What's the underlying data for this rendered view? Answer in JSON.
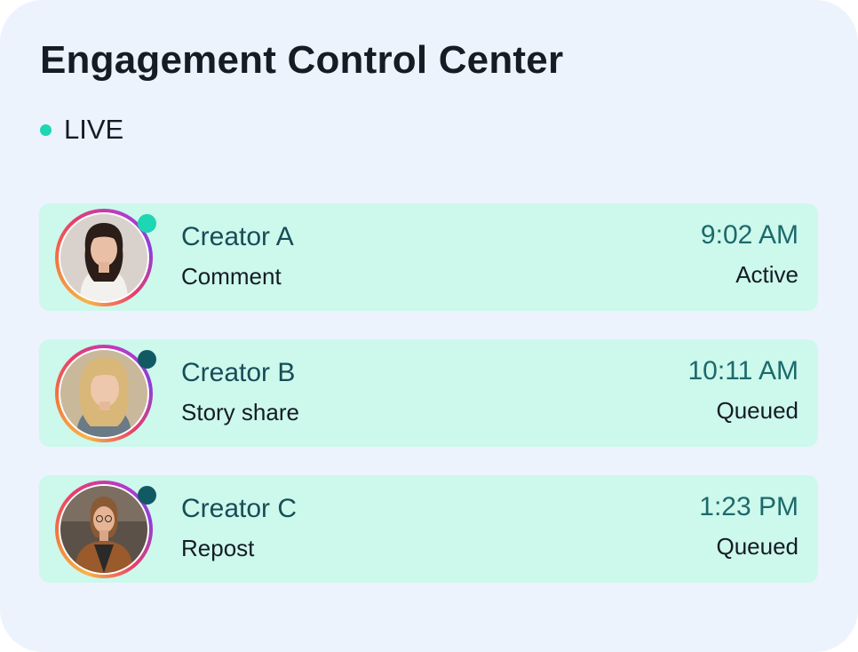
{
  "header": {
    "title": "Engagement Control Center",
    "live_label": "LIVE",
    "live_color": "#1dd6b2"
  },
  "colors": {
    "card_background": "#ecf3fc",
    "row_background": "#cdf8ec",
    "title": "#141c24",
    "time": "#1b6a6b",
    "status_active": "#1dd6b2",
    "status_queued": "#125a63"
  },
  "rows": [
    {
      "name": "Creator A",
      "action": "Comment",
      "time": "9:02 AM",
      "state": "Active",
      "status_color": "#1dd6b2"
    },
    {
      "name": "Creator B",
      "action": "Story share",
      "time": "10:11 AM",
      "state": "Queued",
      "status_color": "#125a63"
    },
    {
      "name": "Creator C",
      "action": "Repost",
      "time": "1:23 PM",
      "state": "Queued",
      "status_color": "#125a63"
    }
  ]
}
